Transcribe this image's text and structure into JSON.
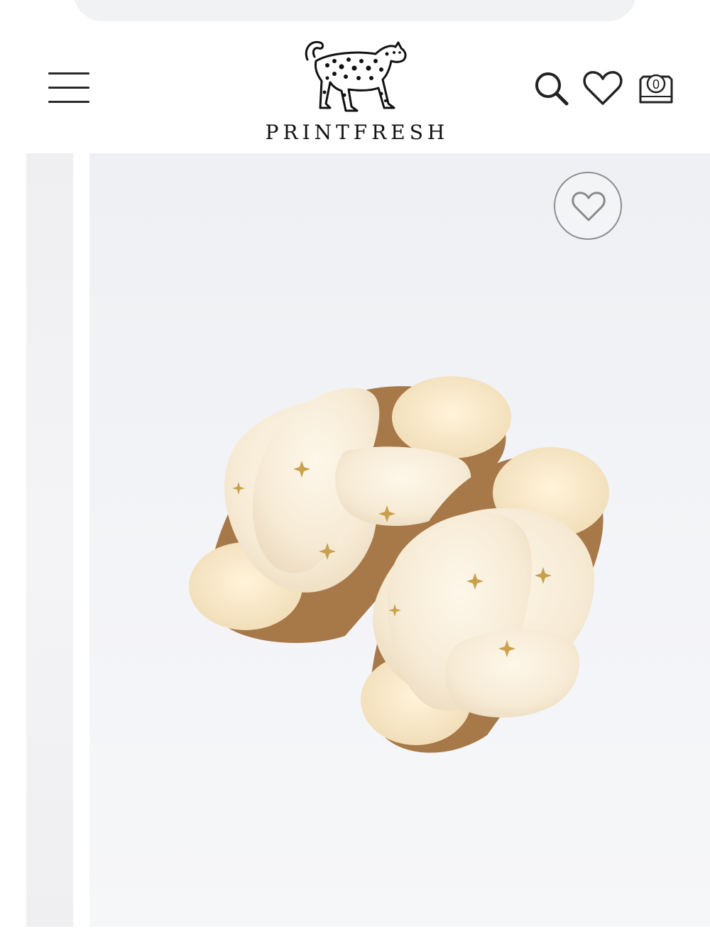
{
  "brand": {
    "name": "PRINTFRESH",
    "logo_icon": "leopard-icon"
  },
  "header": {
    "menu_icon": "hamburger-icon",
    "search_icon": "search-icon",
    "wishlist_icon": "heart-icon",
    "bag_icon": "shopping-bag-icon",
    "bag_count": "0"
  },
  "gallery": {
    "wishlist_icon": "heart-outline-icon",
    "product_image": "fluffy-cream-slippers-with-gold-stars"
  },
  "colors": {
    "text": "#111111",
    "background": "#ffffff",
    "photo_bg": "#f2f3f6",
    "slipper": "#f7ecd8",
    "sole": "#a77848",
    "star": "#c9a14a"
  }
}
